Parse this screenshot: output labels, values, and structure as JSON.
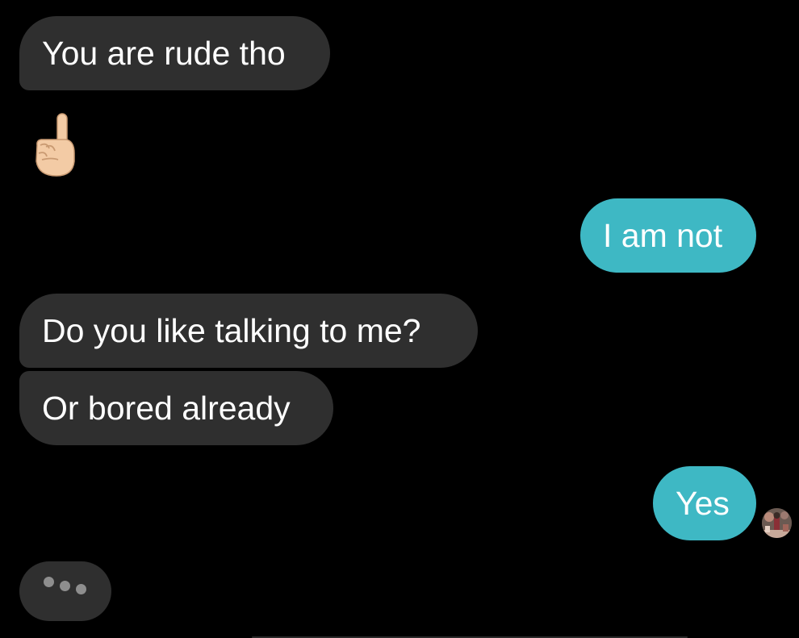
{
  "colors": {
    "background": "#000000",
    "incoming_bubble": "#2f2f2f",
    "outgoing_bubble": "#3eb8c4",
    "text": "#ffffff",
    "typing_dot": "#8e8e8e"
  },
  "messages": [
    {
      "direction": "incoming",
      "text": "You are rude tho"
    },
    {
      "direction": "incoming",
      "type": "emoji",
      "emoji": "☝🏻",
      "icon": "index-pointing-up-emoji"
    },
    {
      "direction": "outgoing",
      "text": "I am not"
    },
    {
      "direction": "incoming",
      "text": "Do you like talking to me?"
    },
    {
      "direction": "incoming",
      "text": "Or bored already"
    },
    {
      "direction": "outgoing",
      "text": "Yes"
    }
  ],
  "read_receipt": {
    "icon": "sender-avatar"
  },
  "typing_indicator": {
    "icon": "typing-dots",
    "dots": 3
  }
}
